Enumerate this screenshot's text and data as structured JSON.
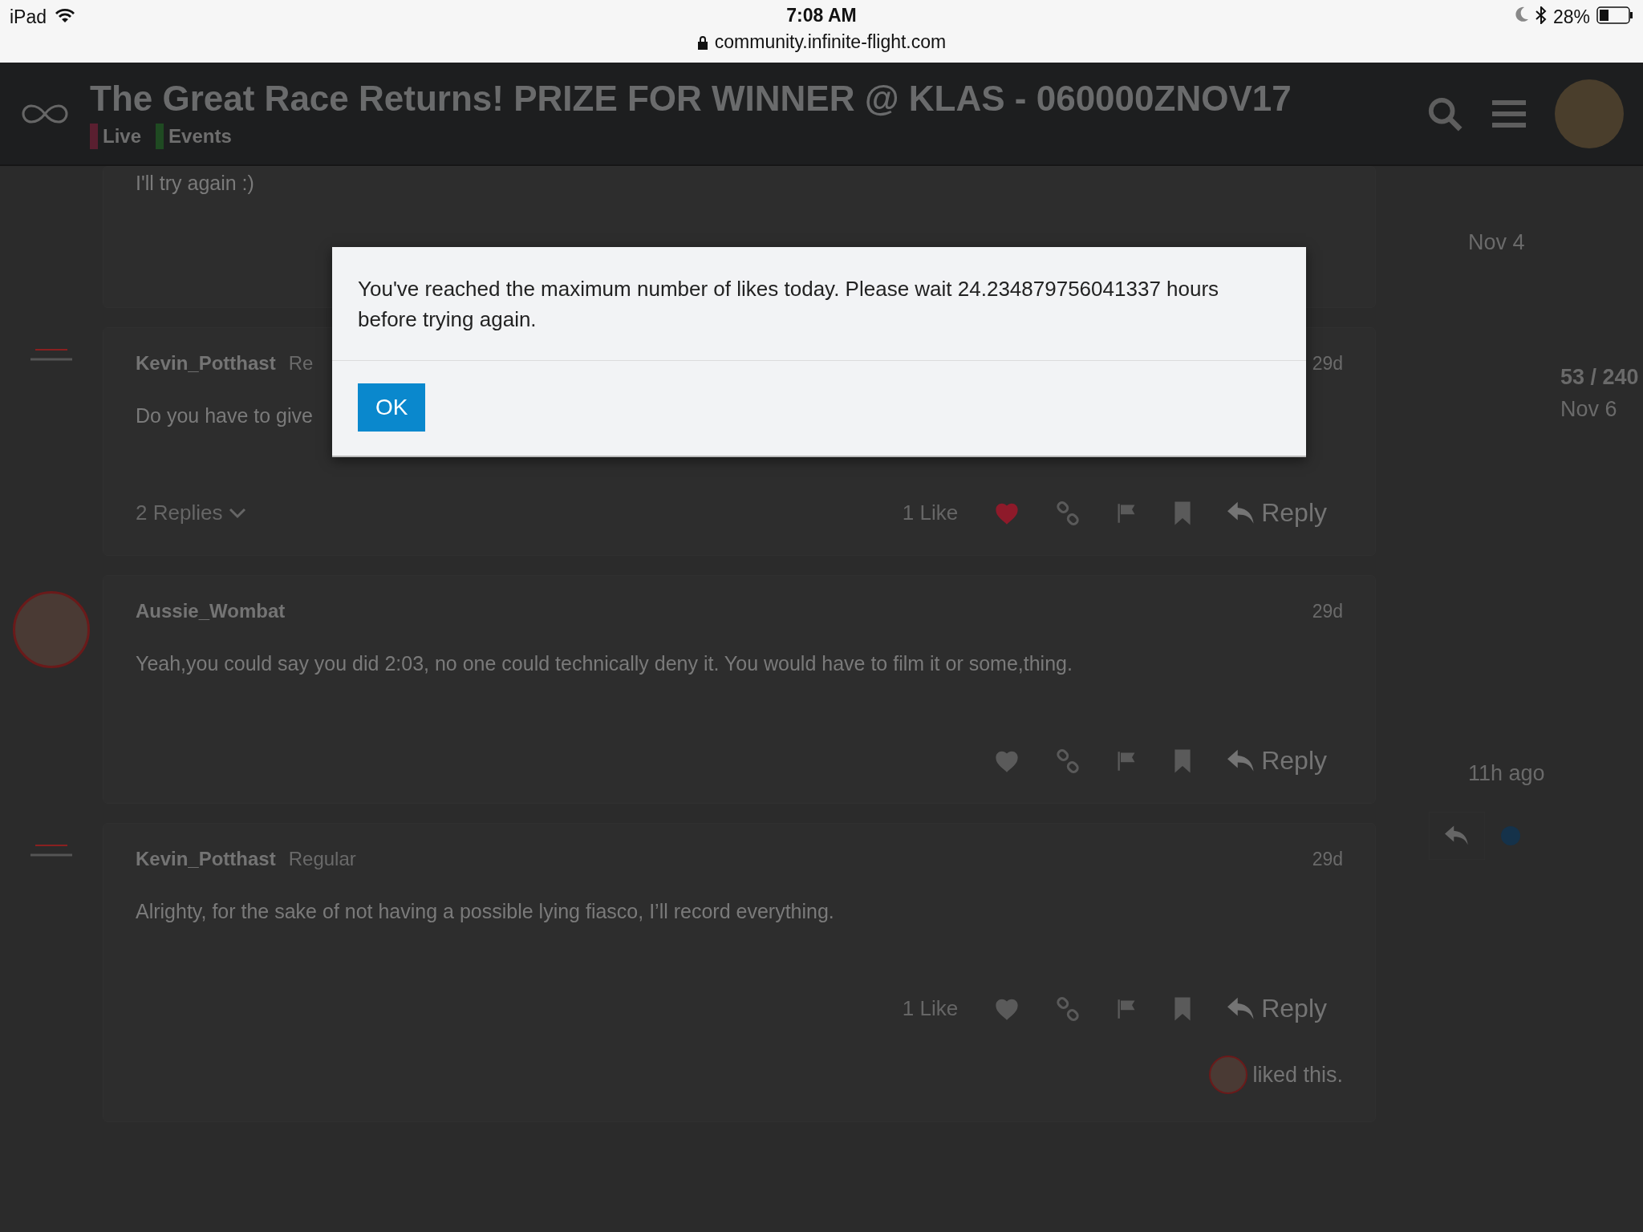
{
  "status_bar": {
    "device": "iPad",
    "time": "7:08 AM",
    "url": "community.infinite-flight.com",
    "battery": "28%"
  },
  "header": {
    "title": "The Great Race Returns! PRIZE FOR WINNER @ KLAS - 060000ZNOV17",
    "categories": [
      {
        "label": "Live",
        "color": "#5a1f30"
      },
      {
        "label": "Events",
        "color": "#1f4a22"
      }
    ]
  },
  "posts": [
    {
      "kind": "partial",
      "body": "I'll try again :)"
    },
    {
      "kind": "logo",
      "author": "Kevin_Potthast",
      "role": "Re",
      "date": "29d",
      "body": "Do you have to give",
      "replies": "2 Replies",
      "likes": "1 Like",
      "liked": true,
      "reply": "Reply"
    },
    {
      "kind": "photo",
      "author": "Aussie_Wombat",
      "date": "29d",
      "body": "Yeah,you could say you did 2:03, no one could technically deny it. You would have to film it or some,thing.",
      "liked": false,
      "reply": "Reply"
    },
    {
      "kind": "logo",
      "author": "Kevin_Potthast",
      "role": "Regular",
      "date": "29d",
      "body": "Alrighty, for the sake of not having a possible lying fiasco, I’ll record everything.",
      "likes": "1 Like",
      "liked": false,
      "reply": "Reply",
      "liked_by": "liked this."
    }
  ],
  "timeline": {
    "start": "Nov 4",
    "position": "53 / 240",
    "position_date": "Nov 6",
    "end": "11h ago"
  },
  "dialog": {
    "message": "You've reached the maximum number of likes today. Please wait 24.234879756041337 hours before trying again.",
    "button": "OK"
  }
}
